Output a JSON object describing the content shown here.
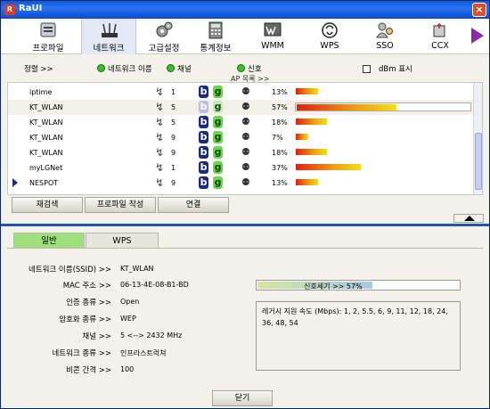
{
  "window": {
    "title": "RaUI",
    "close_label": "×"
  },
  "toolbar": {
    "items": [
      {
        "label": "프로파일",
        "icon": "profile-icon"
      },
      {
        "label": "네트워크",
        "icon": "network-icon"
      },
      {
        "label": "고급설정",
        "icon": "advanced-icon"
      },
      {
        "label": "통계정보",
        "icon": "statistics-icon"
      },
      {
        "label": "WMM",
        "icon": "wmm-icon"
      },
      {
        "label": "WPS",
        "icon": "wps-icon"
      },
      {
        "label": "SSO",
        "icon": "sso-icon"
      },
      {
        "label": "CCX",
        "icon": "ccx-icon"
      }
    ]
  },
  "filter": {
    "sort_label": "정렬 >>",
    "network_name_label": "네트워크 이름",
    "channel_label": "채널",
    "signal_label": "신호",
    "dbm_label": "dBm 표시",
    "ap_list_label": "AP 목록 >>"
  },
  "ap_list": [
    {
      "ssid": "iptime",
      "channel": "1",
      "signal": "13%",
      "signal_value": 13,
      "b": "b",
      "g": "g",
      "dim": false,
      "selected": false,
      "current": false
    },
    {
      "ssid": "KT_WLAN",
      "channel": "5",
      "signal": "57%",
      "signal_value": 57,
      "b": "b",
      "g": "g",
      "dim": true,
      "selected": true,
      "current": false
    },
    {
      "ssid": "KT_WLAN",
      "channel": "5",
      "signal": "18%",
      "signal_value": 18,
      "b": "b",
      "g": "g",
      "dim": false,
      "selected": false,
      "current": false
    },
    {
      "ssid": "KT_WLAN",
      "channel": "9",
      "signal": "7%",
      "signal_value": 7,
      "b": "b",
      "g": "g",
      "dim": false,
      "selected": false,
      "current": false
    },
    {
      "ssid": "KT_WLAN",
      "channel": "9",
      "signal": "18%",
      "signal_value": 18,
      "b": "b",
      "g": "g",
      "dim": false,
      "selected": false,
      "current": false
    },
    {
      "ssid": "myLGNet",
      "channel": "1",
      "signal": "37%",
      "signal_value": 37,
      "b": "b",
      "g": "g",
      "dim": false,
      "selected": false,
      "current": false
    },
    {
      "ssid": "NESPOT",
      "channel": "9",
      "signal": "13%",
      "signal_value": 13,
      "b": "b",
      "g": "g",
      "dim": false,
      "selected": false,
      "current": true
    }
  ],
  "buttons": {
    "rescan": "재검색",
    "create_profile": "프로파일 작성",
    "connect": "연결",
    "close": "닫기"
  },
  "tabs": {
    "general": "일반",
    "wps": "WPS"
  },
  "details": {
    "ssid_label": "네트워크 이름(SSID) >>",
    "ssid_value": "KT_WLAN",
    "mac_label": "MAC 주소 >>",
    "mac_value": "06-13-4E-08-B1-BD",
    "auth_label": "인증 종류 >>",
    "auth_value": "Open",
    "enc_label": "암호화 종류 >>",
    "enc_value": "WEP",
    "channel_label": "채널 >>",
    "channel_value": "5 <--> 2432 MHz",
    "nettype_label": "네트워크 종류 >>",
    "nettype_value": "인프라스트럭쳐",
    "beacon_label": "비콘 간격 >>",
    "beacon_value": "100",
    "signal_strength_label": "신호세기 >> 57%",
    "signal_strength_value": 57,
    "rates_text": "레거시 지원 속도 (Mbps): 1, 2, 5.5, 6, 9, 11, 12, 18, 24, 36, 48, 54"
  },
  "colors": {
    "accent": "#1f57b0",
    "active_tab": "#9de07c",
    "bar_start": "#e02010",
    "bar_end": "#f0e010"
  }
}
